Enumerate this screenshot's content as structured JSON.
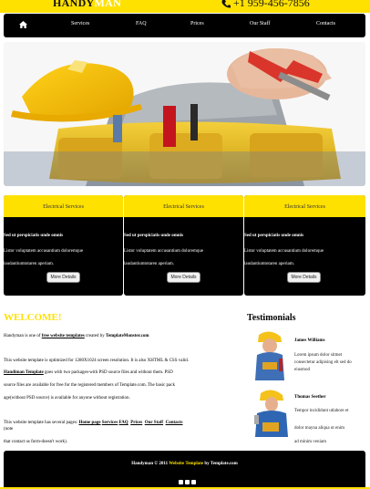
{
  "header": {
    "logo_part1": "HANDY",
    "logo_part2": "MAN",
    "phone": "+1 959-456-7856",
    "accent_color": "#ffe100"
  },
  "nav": {
    "home_icon": "home-icon",
    "items": [
      "Services",
      "FAQ",
      "Prices",
      "Our Staff",
      "Contacts"
    ]
  },
  "hero": {
    "image_alt_icon": "handyman-photo"
  },
  "cards": [
    {
      "title": "Electrical Services",
      "bold_text": "Sed ut perspiciatis unde omnis",
      "text_line1": "Listor voluptatem accusantium doloremque",
      "text_line2": "laudantiumtotaren aperiam.",
      "button": "More Details"
    },
    {
      "title": "Electrical Services",
      "bold_text": "Sed ut perspiciatis unde omnis",
      "text_line1": "Listor voluptatem accusantium doloremque",
      "text_line2": "laudantiumtotaren aperiam.",
      "button": "More Details"
    },
    {
      "title": "Electrical Services",
      "bold_text": "Sed ut perspiciatis unde omnis",
      "text_line1": "Listor voluptatem accusantium doloremque",
      "text_line2": "laudantiumtotaren aperiam.",
      "button": "More Details"
    }
  ],
  "welcome": {
    "heading": "WELCOME!",
    "line1_pre": "Handyman is one of ",
    "line1_link": "free website templates",
    "line1_mid": " created by ",
    "line1_link2": "TemplateMonster.com",
    "p2_line1": "This website template is optimized for 1280X1024 screen resolution. It is also XHTML & CSS valid.",
    "p2_link": "Handiman Template",
    "p2_line2": " goes with two packages-with PSD source files and without them. PSD",
    "p2_line3": "source files are available for free for the registered members of Template.com. The basic pack",
    "p2_line4": "age(without PSD source) is available for anyone without registration.",
    "p3_pre": "This website template has several pages: ",
    "p3_links": [
      "Home page",
      "Services",
      "FAQ",
      "Prices",
      "Our Staff",
      "Contacts"
    ],
    "p3_suffix": " (note",
    "p3_line2": "that contact us form-doesn't work)."
  },
  "testimonials": {
    "heading": "Testimonials",
    "items": [
      {
        "name": "James Williams",
        "text": "Lorem ipsum dolor sitmet consectetur adipising elt sed do eiusmod"
      },
      {
        "name": "Thomas Seether",
        "text": "Tempor incididunt utlabore et",
        "text2": "dolor mayna aliqua ut enim",
        "text3": "ad minim veniam"
      }
    ]
  },
  "footer": {
    "brand": "Handyman",
    "copy": " © 2011 ",
    "link": "Website Template",
    "by": " by Template.com",
    "social_icons": [
      "facebook-icon",
      "twitter-icon",
      "linkedin-icon"
    ]
  }
}
